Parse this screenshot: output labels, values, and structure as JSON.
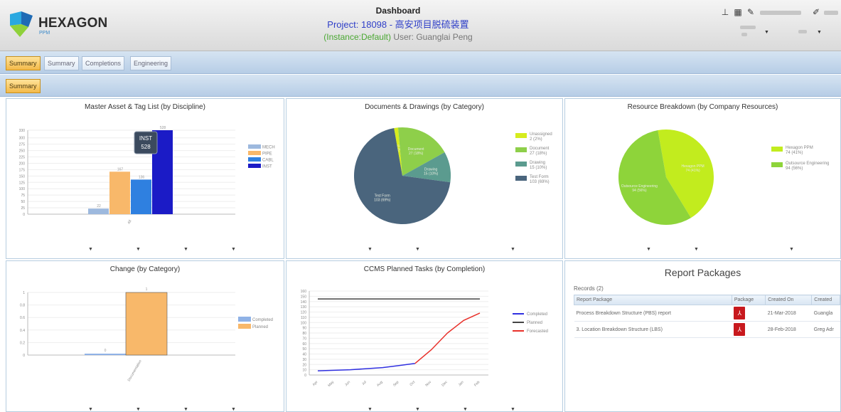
{
  "header": {
    "brand": "HEXAGON",
    "brand_sub": "PPM",
    "title": "Dashboard",
    "project": "Project: 18098 - 高安项目脱硫装置",
    "instance": "(Instance:Default)",
    "user": "User: Guanglai Peng",
    "tools": [
      {
        "icon": "hierarchy-icon",
        "glyph": "⊥"
      },
      {
        "icon": "grid-icon",
        "glyph": "▦"
      },
      {
        "icon": "edit-icon",
        "glyph": "✎"
      },
      {
        "icon": "pin-icon",
        "glyph": "✐"
      }
    ]
  },
  "tabs_primary": [
    "Summary",
    "Summary",
    "Completions",
    "Engineering"
  ],
  "tabs_secondary": [
    "Summary"
  ],
  "colors": {
    "accent_tab": "#f3b949",
    "header_bg": "#e4e4e4",
    "tabbar_bg": "#c6d9ec"
  },
  "panels": {
    "master_asset": {
      "title": "Master Asset & Tag List (by Discipline)",
      "chart_data": {
        "type": "bar",
        "categories": [
          "All"
        ],
        "series": [
          {
            "name": "MECH",
            "value": 22,
            "color": "#9db9de"
          },
          {
            "name": "PIPE",
            "value": 167,
            "color": "#f8b86a"
          },
          {
            "name": "CABL",
            "value": 136,
            "color": "#2f80e0"
          },
          {
            "name": "INST",
            "value": 528,
            "color": "#1b1bc6"
          }
        ],
        "ylim": [
          0,
          330
        ],
        "yticks": [
          0,
          25,
          50,
          75,
          100,
          125,
          150,
          175,
          200,
          225,
          250,
          275,
          300,
          330
        ],
        "tooltip": {
          "series": "INST",
          "value": "528"
        },
        "legend": "right"
      }
    },
    "documents": {
      "title": "Documents & Drawings (by Category)",
      "chart_data": {
        "type": "pie",
        "slices": [
          {
            "label": "Unassigned",
            "value": 2,
            "pct": "(2%)",
            "color": "#d6ec1e"
          },
          {
            "label": "Document",
            "value": 27,
            "pct": "(18%)",
            "color": "#8ecf4a"
          },
          {
            "label": "Drawing",
            "value": 15,
            "pct": "(10%)",
            "color": "#5b9b8f"
          },
          {
            "label": "Test Form",
            "value": 103,
            "pct": "(69%)",
            "color": "#4a657d"
          }
        ],
        "legend": "right"
      }
    },
    "resource": {
      "title": "Resource Breakdown (by Company Resources)",
      "chart_data": {
        "type": "pie",
        "slices": [
          {
            "label": "Hexagon PPM",
            "value": 74,
            "pct": "(41%)",
            "color": "#c2ec1e"
          },
          {
            "label": "Outsource Engineering",
            "value": 94,
            "pct": "(56%)",
            "color": "#8ed43a"
          }
        ],
        "legend": "right"
      }
    },
    "change": {
      "title": "Change (by Category)",
      "chart_data": {
        "type": "bar",
        "categories": [
          "Documentation"
        ],
        "series": [
          {
            "name": "Completed",
            "value": 0,
            "color": "#8fb2e6"
          },
          {
            "name": "Planned",
            "value": 1,
            "color": "#f8b86a"
          }
        ],
        "ylim": [
          0,
          1
        ],
        "yticks": [
          0,
          0.2,
          0.4,
          0.6,
          0.8,
          1
        ],
        "legend": "right"
      }
    },
    "ccms": {
      "title": "CCMS Planned Tasks (by Completion)",
      "chart_data": {
        "type": "line",
        "x": [
          "Apr",
          "May",
          "Jun",
          "Jul",
          "Aug",
          "Sep",
          "Oct",
          "Nov",
          "Dec",
          "Jan",
          "Feb"
        ],
        "series": [
          {
            "name": "Completed",
            "values": [
              8,
              9,
              10,
              12,
              14,
              18,
              22,
              null,
              null,
              null,
              null
            ],
            "color": "#3030e0"
          },
          {
            "name": "Planned",
            "values": [
              145,
              145,
              145,
              145,
              145,
              145,
              145,
              145,
              145,
              145,
              145
            ],
            "color": "#444444"
          },
          {
            "name": "Forecasted",
            "values": [
              null,
              null,
              null,
              null,
              null,
              null,
              22,
              48,
              80,
              104,
              118
            ],
            "color": "#e8302a"
          }
        ],
        "ylim": [
          0,
          160
        ],
        "yticks": [
          0,
          10,
          20,
          30,
          40,
          50,
          60,
          70,
          80,
          90,
          100,
          110,
          120,
          130,
          140,
          150,
          160
        ],
        "legend": "right"
      }
    },
    "report_packages": {
      "title": "Report Packages",
      "records": "Records (2)",
      "columns": [
        "Report Package",
        "Package",
        "Created On",
        "Created"
      ],
      "rows": [
        {
          "name": "Process Breakdown Structure (PBS) report",
          "created_on": "21-Mar-2018",
          "created_by": "Guangla"
        },
        {
          "name": "3. Location Breakdown Structure (LBS)",
          "created_on": "28-Feb-2018",
          "created_by": "Greg Adr"
        }
      ]
    }
  }
}
